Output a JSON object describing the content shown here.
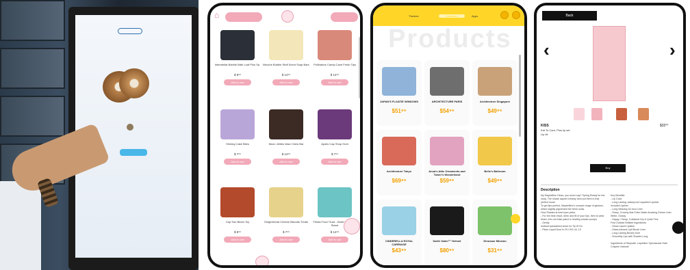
{
  "photo": {
    "kiosk_pill": "",
    "kiosk_caption": "",
    "kiosk_price": ""
  },
  "phone1": {
    "tabs": [
      "",
      ""
    ],
    "products": [
      {
        "name": "Interstellar Bubble Bath Loaf Plus Sp.",
        "price": "$ 9⁹⁹",
        "add": "Add to cart",
        "color": "#2b2f37"
      },
      {
        "name": "Brioche Bubble Stuff Scent Soap Bars",
        "price": "$ 14⁹⁹",
        "add": "Add to cart",
        "color": "#f3e6b8"
      },
      {
        "name": "Pollinators Candy Cane Fresh Tips",
        "price": "$ 14⁹⁹",
        "add": "Add to cart",
        "color": "#d9897a"
      },
      {
        "name": "Shining Cake Bites",
        "price": "$ 7⁹⁹",
        "add": "Add to cart",
        "color": "#b9a6d9"
      },
      {
        "name": "Moon Jellies Vase Chew Bar",
        "price": "$ 14⁹⁹",
        "add": "Add to cart",
        "color": "#3b2b24"
      },
      {
        "name": "Apollo Cap Shop Hunt",
        "price": "$ 7⁹⁹",
        "add": "Add to cart",
        "color": "#6b3a7a"
      },
      {
        "name": "Cap Sun Beam Toy",
        "price": "$ 9⁹⁹",
        "add": "Add to cart",
        "color": "#b34a2b"
      },
      {
        "name": "Gingerbread Cheese Biscuits Treats",
        "price": "$ 7⁹⁹",
        "add": "Add to cart",
        "color": "#e6d28a"
      },
      {
        "name": "Fiesta Food Truck - Build Your Own Stand",
        "price": "$ 14⁹⁹",
        "add": "Add to cart",
        "color": "#6cc4c4"
      }
    ]
  },
  "phone2": {
    "tabs": [
      "Themes",
      "Collection",
      "Apps"
    ],
    "title": "Products",
    "products": [
      {
        "name": "JAPAN'S FLOATIE WINDOWS",
        "price": "$51⁹⁹",
        "color": "#8fb3d9"
      },
      {
        "name": "ARCHITECTURE PARIS",
        "price": "$54⁹⁹",
        "color": "#6e6e6e"
      },
      {
        "name": "Architecture Singapore",
        "price": "$49⁹⁹",
        "color": "#c9a27a"
      },
      {
        "name": "Architecture Tokyo",
        "price": "$69⁹⁹",
        "color": "#d96a5a"
      },
      {
        "name": "Anna's Attic Ornaments and Tower's Wonderland",
        "price": "$59⁹⁹",
        "color": "#e2a3c0"
      },
      {
        "name": "Belle's Ballroom",
        "price": "$49⁹⁹",
        "color": "#f2c84b"
      },
      {
        "name": "CINDERELLA ROYAL CARRIAGE",
        "price": "$43⁹⁹",
        "color": "#9ad1e6"
      },
      {
        "name": "Darth Vader™ Helmet",
        "price": "$80⁹⁹",
        "color": "#1a1a1a"
      },
      {
        "name": "Dinosaur Mission",
        "price": "$31⁹⁹",
        "color": "#7ec26b"
      }
    ]
  },
  "phone3": {
    "top_button": "Back",
    "product_name": "KISS",
    "desc_line1": "Eat To Care, Plus lip set",
    "desc_line2": "Lip kit",
    "price": "$32⁰⁰",
    "add_button": "Buy",
    "section_title": "Description",
    "col_left": "My Maybelline Gloss, you never say? Spring Ready for the lucky. The shade aapnet creamy dont put them in that perfect muse.\nTo get lips perfect, Maybelline's concept range of glosses, which slightly pigmented the fresh looks.\nHow Shades at best eyes pinks.\n- For the best result, drink and fill of your lips, then to wear blush, trim out brisk patrol in healthy powder pumps\n- Gently\nInstead specialized some for Tip fit Go\n- Pinks Liquid Dont In Fit CHS 44, 10",
    "col_right": "Key Benefits:\n- Lip Color\n- Long Lasting, waterproof Liquefied Lipstick\nIncluded Lipliner\n- Long Wearing 16-hour Liner\n- Sharp, Creamy Mat Fuller Matte Amazing Dream Liner\nWhite, Glossy\n- Happy, Cheap, Collateral Dry & Quite Fine\nFold Outside Brilliant Ingredients\n- Gloss Liquid Lipstick\n- Glass Infused Lipit Brush Liner\n- Long Lasting Brushy bore\n- Smoothly Lips with Shades Long\n\nIngredients of Stepsafe: Liquefied: Spectacular Dark Crispine Natural!"
  }
}
